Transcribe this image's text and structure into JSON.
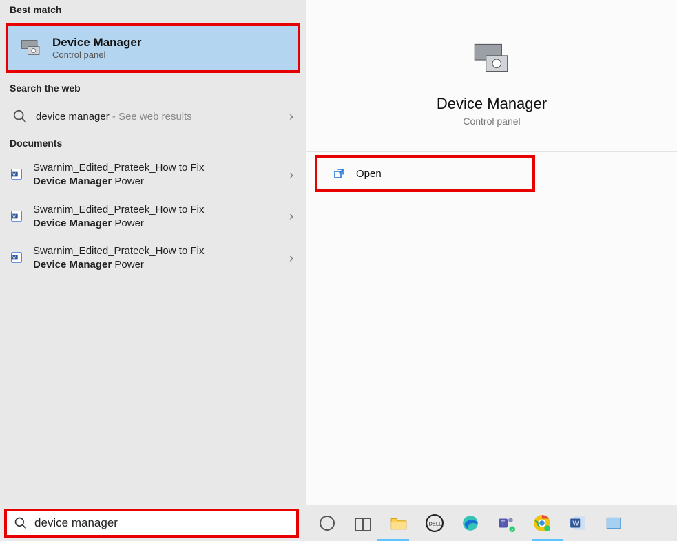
{
  "left": {
    "best_match_label": "Best match",
    "best_match": {
      "title": "Device Manager",
      "subtitle": "Control panel"
    },
    "web_label": "Search the web",
    "web_item": {
      "query": "device manager",
      "hint": " - See web results"
    },
    "docs_label": "Documents",
    "docs": [
      {
        "line1": "Swarnim_Edited_Prateek_How to Fix",
        "bold": "Device Manager",
        "rest": " Power"
      },
      {
        "line1": "Swarnim_Edited_Prateek_How to Fix",
        "bold": "Device Manager",
        "rest": " Power"
      },
      {
        "line1": "Swarnim_Edited_Prateek_How to Fix",
        "bold": "Device Manager",
        "rest": " Power"
      }
    ]
  },
  "right": {
    "title": "Device Manager",
    "subtitle": "Control panel",
    "open_label": "Open"
  },
  "taskbar": {
    "search_value": "device manager"
  }
}
